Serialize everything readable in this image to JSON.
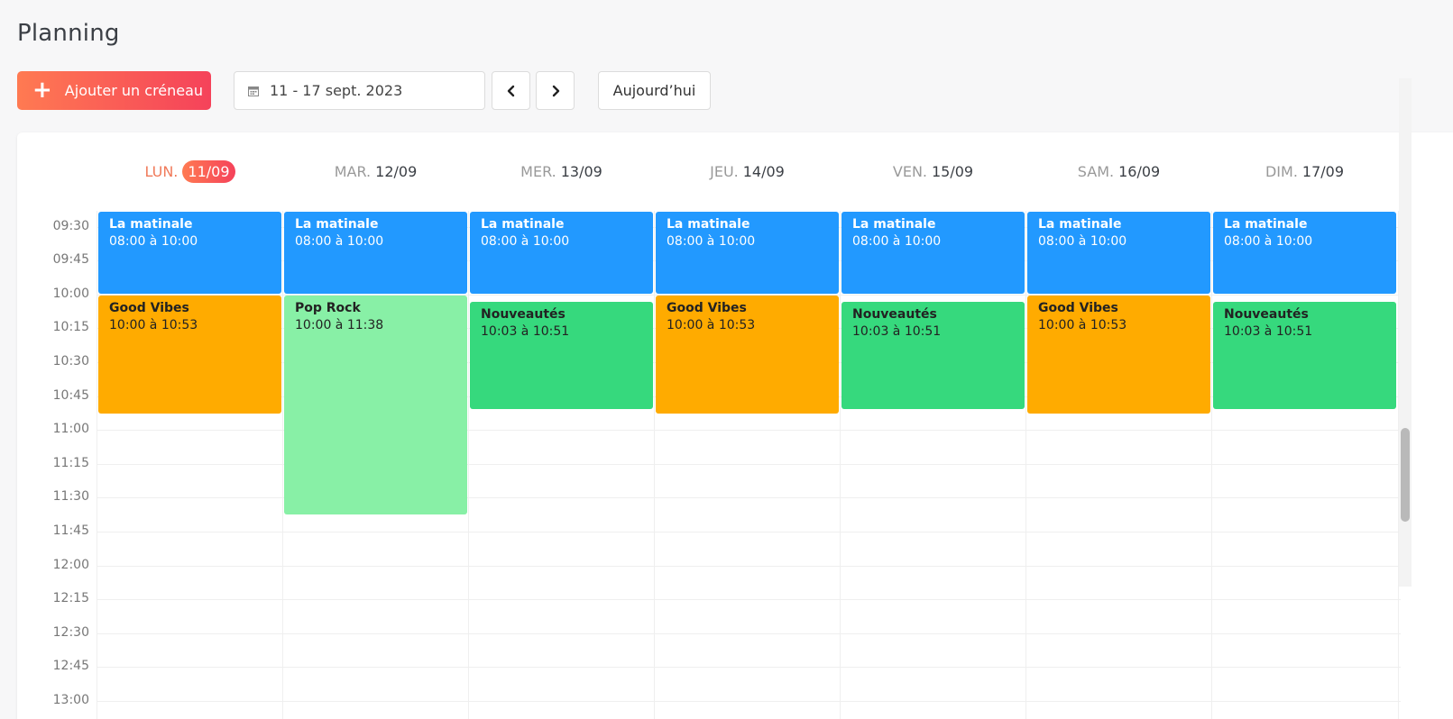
{
  "page": {
    "title": "Planning"
  },
  "toolbar": {
    "add_label": "Ajouter un créneau",
    "date_range": "11 - 17 sept. 2023",
    "today_label": "Aujourd’hui"
  },
  "colors": {
    "accent_start": "#ff7a52",
    "accent_end": "#f5425a",
    "event_blue": "#2299ff",
    "event_orange": "#ffab00",
    "event_green": "#36d97d",
    "event_lightgreen": "#88f0a6"
  },
  "days": [
    {
      "name": "LUN.",
      "date": "11/09",
      "today": true
    },
    {
      "name": "MAR.",
      "date": "12/09",
      "today": false
    },
    {
      "name": "MER.",
      "date": "13/09",
      "today": false
    },
    {
      "name": "JEU.",
      "date": "14/09",
      "today": false
    },
    {
      "name": "VEN.",
      "date": "15/09",
      "today": false
    },
    {
      "name": "SAM.",
      "date": "16/09",
      "today": false
    },
    {
      "name": "DIM.",
      "date": "17/09",
      "today": false
    }
  ],
  "time_slots": [
    "09:30",
    "09:45",
    "10:00",
    "10:15",
    "10:30",
    "10:45",
    "11:00",
    "11:15",
    "11:30",
    "11:45",
    "12:00",
    "12:15",
    "12:30",
    "12:45",
    "13:00"
  ],
  "events": [
    {
      "day": 0,
      "title": "La matinale",
      "time": "08:00 à 10:00",
      "color": "blue"
    },
    {
      "day": 1,
      "title": "La matinale",
      "time": "08:00 à 10:00",
      "color": "blue"
    },
    {
      "day": 2,
      "title": "La matinale",
      "time": "08:00 à 10:00",
      "color": "blue"
    },
    {
      "day": 3,
      "title": "La matinale",
      "time": "08:00 à 10:00",
      "color": "blue"
    },
    {
      "day": 4,
      "title": "La matinale",
      "time": "08:00 à 10:00",
      "color": "blue"
    },
    {
      "day": 5,
      "title": "La matinale",
      "time": "08:00 à 10:00",
      "color": "blue"
    },
    {
      "day": 6,
      "title": "La matinale",
      "time": "08:00 à 10:00",
      "color": "blue"
    },
    {
      "day": 0,
      "title": "Good Vibes",
      "time": "10:00 à 10:53",
      "color": "orange"
    },
    {
      "day": 1,
      "title": "Pop Rock",
      "time": "10:00 à 11:38",
      "color": "lightgreen"
    },
    {
      "day": 2,
      "title": "Nouveautés",
      "time": "10:03 à 10:51",
      "color": "green"
    },
    {
      "day": 3,
      "title": "Good Vibes",
      "time": "10:00 à 10:53",
      "color": "orange"
    },
    {
      "day": 4,
      "title": "Nouveautés",
      "time": "10:03 à 10:51",
      "color": "green"
    },
    {
      "day": 5,
      "title": "Good Vibes",
      "time": "10:00 à 10:53",
      "color": "orange"
    },
    {
      "day": 6,
      "title": "Nouveautés",
      "time": "10:03 à 10:51",
      "color": "green"
    }
  ]
}
